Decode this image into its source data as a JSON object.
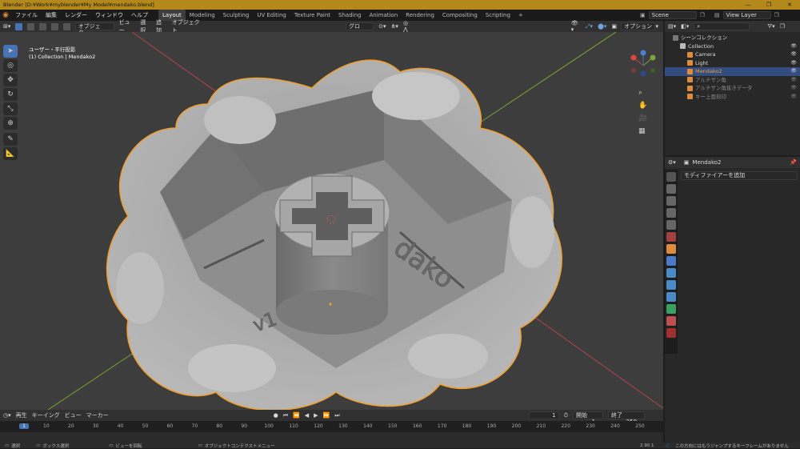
{
  "window": {
    "title": "Blender [D:¥Work¥myblender¥My Model¥mendako.blend]",
    "controls": [
      "—",
      "❐",
      "✕"
    ]
  },
  "topbar": {
    "menus": [
      "ファイル",
      "編集",
      "レンダー",
      "ウィンドウ",
      "ヘルプ"
    ],
    "workspaces": [
      "Layout",
      "Modeling",
      "Sculpting",
      "UV Editing",
      "Texture Paint",
      "Shading",
      "Animation",
      "Rendering",
      "Compositing",
      "Scripting",
      "+"
    ],
    "active_workspace": "Layout",
    "scene": "Scene",
    "view_layer": "View Layer"
  },
  "viewport_header": {
    "mode": "オブジェク...",
    "menus": [
      "ビュー",
      "選択",
      "追加",
      "オブジェクト"
    ],
    "orientation": "グロー...",
    "options": "オプション"
  },
  "viewport": {
    "view_name": "ユーザー・平行投影",
    "collection_label": "(1) Collection | Mendako2",
    "model_text_1": "dako",
    "model_text_2": "v1"
  },
  "outliner": {
    "title": "シーンコレクション",
    "rows": [
      {
        "label": "Collection",
        "indent": 1,
        "color": "#bbbbbb",
        "dim": false,
        "selected": false
      },
      {
        "label": "Camera",
        "indent": 2,
        "color": "#e08a3c",
        "dim": false,
        "selected": false
      },
      {
        "label": "Light",
        "indent": 2,
        "color": "#e08a3c",
        "dim": false,
        "selected": false
      },
      {
        "label": "Mendako2",
        "indent": 2,
        "color": "#e08a3c",
        "dim": false,
        "selected": true
      },
      {
        "label": "アルチザン角",
        "indent": 2,
        "color": "#e08a3c",
        "dim": true,
        "selected": false
      },
      {
        "label": "アルチザン角抜きデータ",
        "indent": 2,
        "color": "#e08a3c",
        "dim": true,
        "selected": false
      },
      {
        "label": "キー上面刻印",
        "indent": 2,
        "color": "#e08a3c",
        "dim": true,
        "selected": false
      }
    ]
  },
  "properties": {
    "object_name": "Mendako2",
    "add_modifier": "モディファイアーを追加"
  },
  "timeline": {
    "menus": [
      "再生",
      "キーイング",
      "ビュー",
      "マーカー"
    ],
    "current_frame": "1",
    "start_label": "開始",
    "start": "1",
    "end_label": "終了",
    "end": "250",
    "ruler": [
      "1",
      "10",
      "20",
      "30",
      "40",
      "50",
      "60",
      "70",
      "80",
      "90",
      "100",
      "110",
      "120",
      "130",
      "140",
      "150",
      "160",
      "170",
      "180",
      "190",
      "200",
      "210",
      "220",
      "230",
      "240",
      "250"
    ]
  },
  "statusbar": {
    "items": [
      "選択",
      "ボックス選択",
      "ビューを回転",
      "オブジェクトコンテクストメニュー"
    ],
    "version": "2.90.1",
    "message": "この方向にはもうジャンプするキーフレームがありません"
  },
  "colors": {
    "accent": "#4772b3",
    "title_bar": "#b4891c",
    "selection_outline": "#f0a030"
  }
}
